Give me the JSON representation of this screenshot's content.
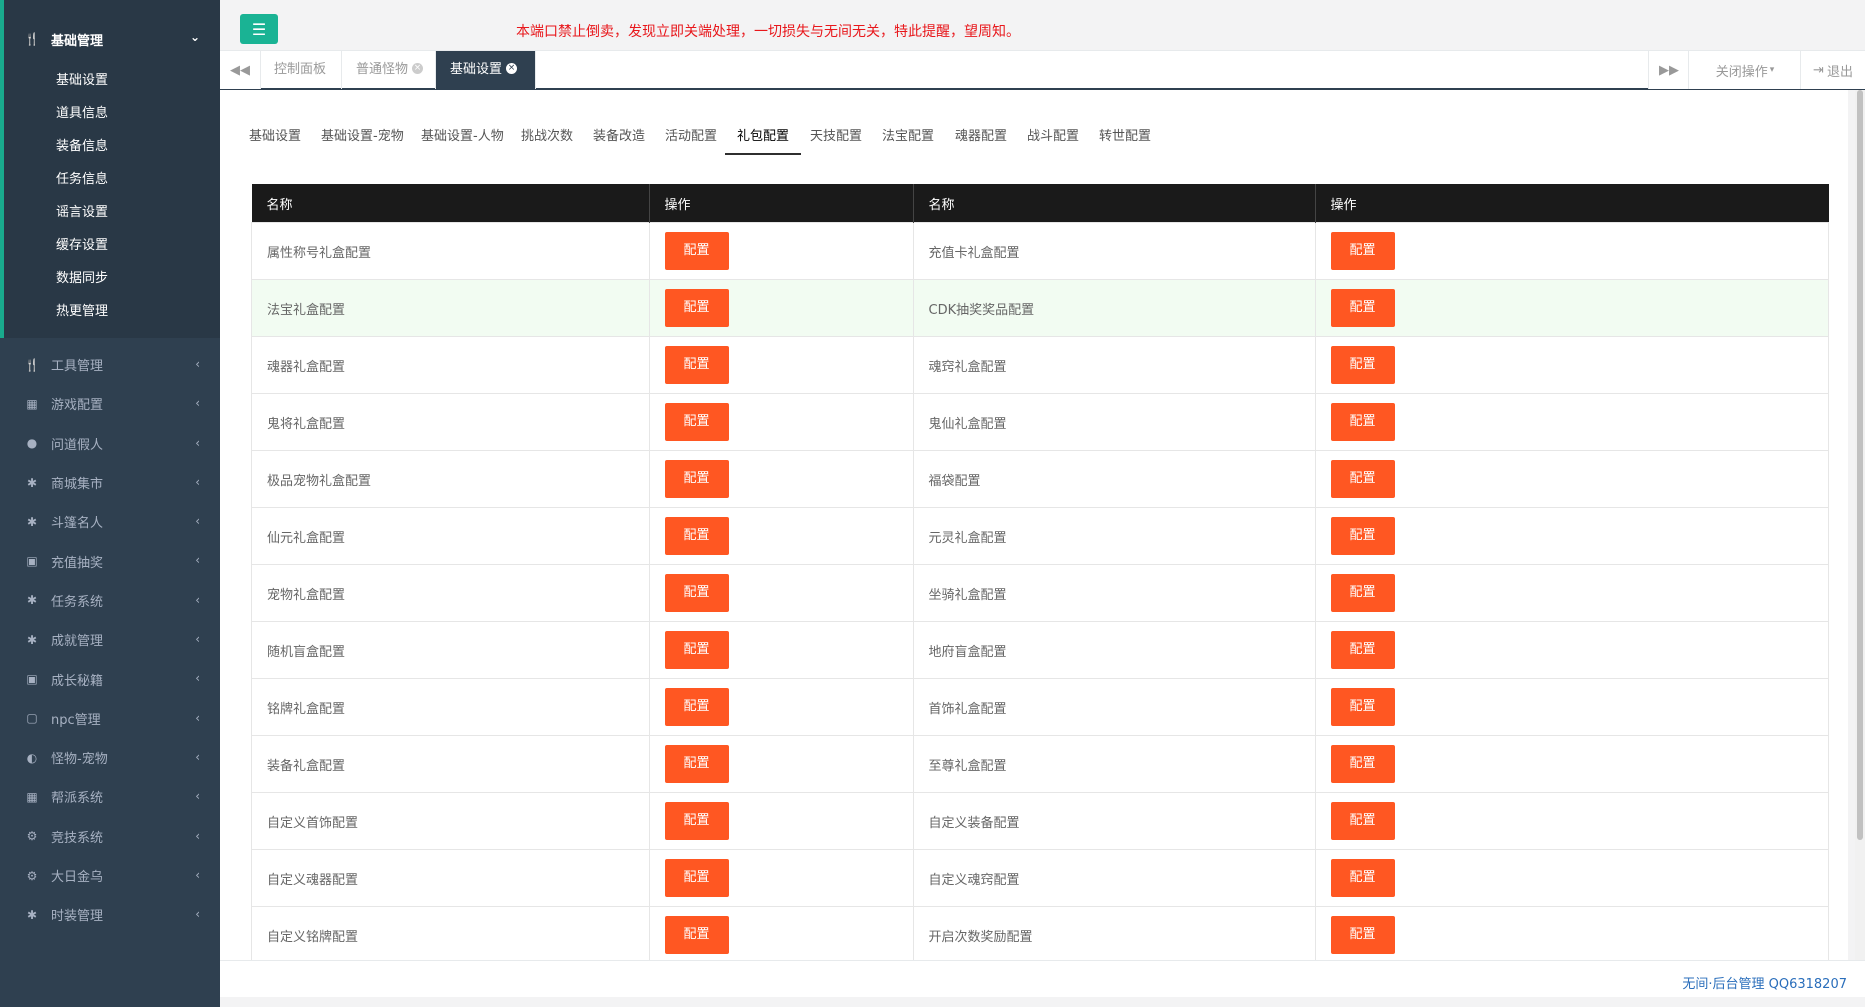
{
  "sidebar": {
    "active_group": {
      "label": "基础管理",
      "icon": "cutlery-icon"
    },
    "sub_items": [
      "基础设置",
      "道具信息",
      "装备信息",
      "任务信息",
      "谣言设置",
      "缓存设置",
      "数据同步",
      "热更管理"
    ],
    "groups": [
      {
        "label": "工具管理",
        "icon": "cutlery-icon"
      },
      {
        "label": "游戏配置",
        "icon": "table-icon"
      },
      {
        "label": "问道假人",
        "icon": "user-icon"
      },
      {
        "label": "商城集市",
        "icon": "gear-icon"
      },
      {
        "label": "斗篷名人",
        "icon": "gear-icon"
      },
      {
        "label": "充值抽奖",
        "icon": "money-icon"
      },
      {
        "label": "任务系统",
        "icon": "gear-icon"
      },
      {
        "label": "成就管理",
        "icon": "gear-icon"
      },
      {
        "label": "成长秘籍",
        "icon": "money-icon"
      },
      {
        "label": "npc管理",
        "icon": "square-icon"
      },
      {
        "label": "怪物-宠物",
        "icon": "adjust-icon"
      },
      {
        "label": "帮派系统",
        "icon": "table-icon"
      },
      {
        "label": "竞技系统",
        "icon": "gears-icon"
      },
      {
        "label": "大日金乌",
        "icon": "gears-icon"
      },
      {
        "label": "时装管理",
        "icon": "gear-icon"
      }
    ]
  },
  "topbar": {
    "notice": "本端口禁止倒卖，发现立即关端处理，一切损失与无间无关，特此提醒，望周知。"
  },
  "tabbar": {
    "tabs": [
      {
        "label": "控制面板",
        "closable": false,
        "active": false
      },
      {
        "label": "普通怪物",
        "closable": true,
        "active": false
      },
      {
        "label": "基础设置",
        "closable": true,
        "active": true
      }
    ],
    "close_ops_label": "关闭操作",
    "exit_label": "退出"
  },
  "subtabs": [
    "基础设置",
    "基础设置-宠物",
    "基础设置-人物",
    "挑战次数",
    "装备改造",
    "活动配置",
    "礼包配置",
    "天技配置",
    "法宝配置",
    "魂器配置",
    "战斗配置",
    "转世配置"
  ],
  "active_subtab": 6,
  "table": {
    "headers": [
      "名称",
      "操作",
      "名称",
      "操作"
    ],
    "button_label": "配置",
    "rows": [
      [
        "属性称号礼盒配置",
        "充值卡礼盒配置"
      ],
      [
        "法宝礼盒配置",
        "CDK抽奖奖品配置"
      ],
      [
        "魂器礼盒配置",
        "魂窍礼盒配置"
      ],
      [
        "鬼将礼盒配置",
        "鬼仙礼盒配置"
      ],
      [
        "极品宠物礼盒配置",
        "福袋配置"
      ],
      [
        "仙元礼盒配置",
        "元灵礼盒配置"
      ],
      [
        "宠物礼盒配置",
        "坐骑礼盒配置"
      ],
      [
        "随机盲盒配置",
        "地府盲盒配置"
      ],
      [
        "铭牌礼盒配置",
        "首饰礼盒配置"
      ],
      [
        "装备礼盒配置",
        "至尊礼盒配置"
      ],
      [
        "自定义首饰配置",
        "自定义装备配置"
      ],
      [
        "自定义魂器配置",
        "自定义魂窍配置"
      ],
      [
        "自定义铭牌配置",
        "开启次数奖励配置"
      ]
    ],
    "highlight_row": 1
  },
  "footer": {
    "text": "无间·后台管理 QQ6318207"
  },
  "colors": {
    "sidebar_bg": "#2f4050",
    "accent": "#1ab394",
    "button": "#ff5722",
    "notice": "#e8171b"
  }
}
